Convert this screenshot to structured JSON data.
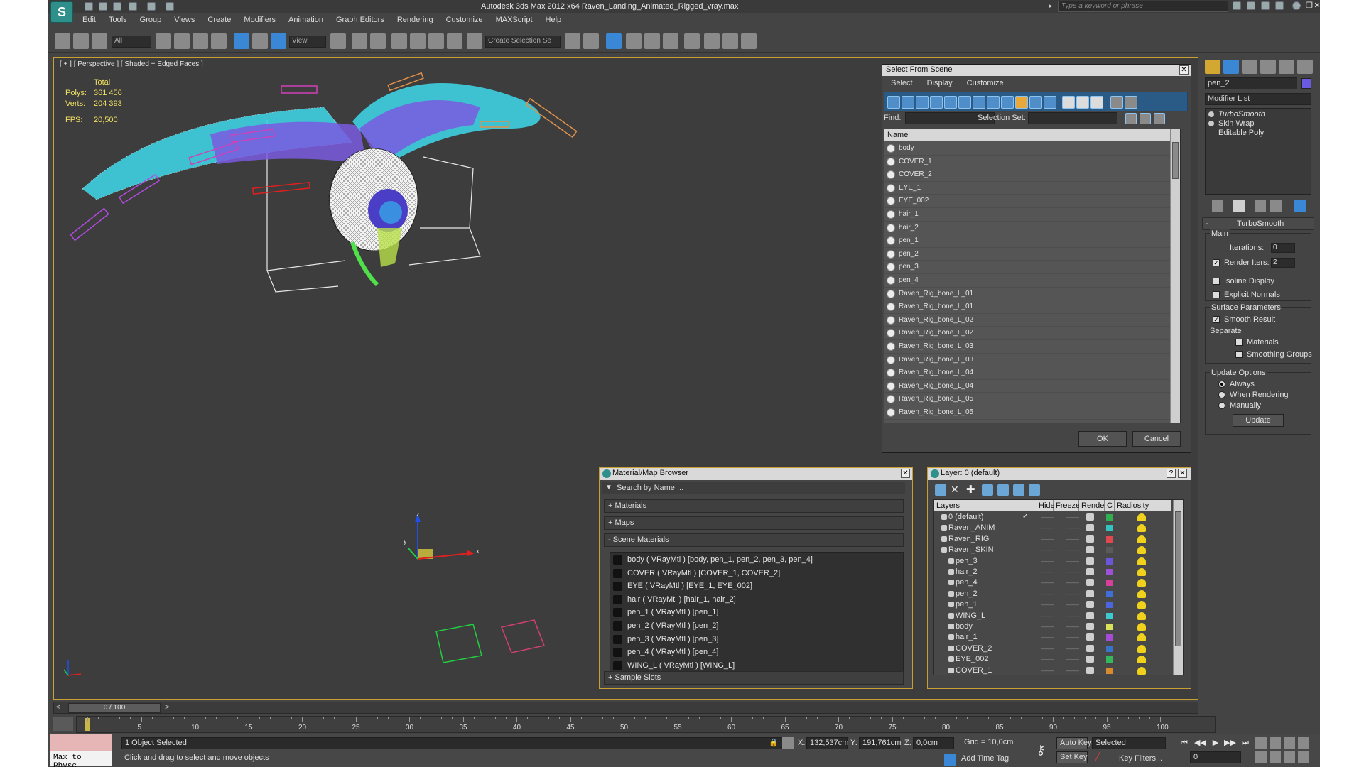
{
  "title": "Autodesk 3ds Max  2012 x64      Raven_Landing_Animated_Rigged_vray.max",
  "app_logo": "S",
  "search_placeholder": "Type a keyword or phrase",
  "menu": [
    "Edit",
    "Tools",
    "Group",
    "Views",
    "Create",
    "Modifiers",
    "Animation",
    "Graph Editors",
    "Rendering",
    "Customize",
    "MAXScript",
    "Help"
  ],
  "toolbar": {
    "selection_filter": "All",
    "ref_coord": "View",
    "named_selection": "Create Selection Se"
  },
  "viewport": {
    "label": "[ + ] [ Perspective ] [ Shaded + Edged Faces ]",
    "stats": {
      "total_label": "Total",
      "polys_label": "Polys:",
      "polys_value": "361 456",
      "verts_label": "Verts:",
      "verts_value": "204 393",
      "fps_label": "FPS:",
      "fps_value": "20,500"
    }
  },
  "select_from_scene": {
    "title": "Select From Scene",
    "menu": [
      "Select",
      "Display",
      "Customize"
    ],
    "find_label": "Find:",
    "selection_set_label": "Selection Set:",
    "column_name": "Name",
    "items": [
      "body",
      "COVER_1",
      "COVER_2",
      "EYE_1",
      "EYE_002",
      "hair_1",
      "hair_2",
      "pen_1",
      "pen_2",
      "pen_3",
      "pen_4",
      "Raven_Rig_bone_L_01",
      "Raven_Rig_bone_L_01",
      "Raven_Rig_bone_L_02",
      "Raven_Rig_bone_L_02",
      "Raven_Rig_bone_L_03",
      "Raven_Rig_bone_L_03",
      "Raven_Rig_bone_L_04",
      "Raven_Rig_bone_L_04",
      "Raven_Rig_bone_L_05",
      "Raven_Rig_bone_L_05"
    ],
    "ok_label": "OK",
    "cancel_label": "Cancel"
  },
  "material_browser": {
    "title": "Material/Map Browser",
    "search_placeholder": "Search by Name ...",
    "sections": {
      "materials": "+ Materials",
      "maps": "+ Maps",
      "scene_materials": "- Scene Materials",
      "sample_slots": "+ Sample Slots"
    },
    "scene_materials": [
      "body  ( VRayMtl )  [body, pen_1, pen_2, pen_3, pen_4]",
      "COVER  ( VRayMtl )  [COVER_1, COVER_2]",
      "EYE  ( VRayMtl )  [EYE_1, EYE_002]",
      "hair  ( VRayMtl )  [hair_1, hair_2]",
      "pen_1  ( VRayMtl )  [pen_1]",
      "pen_2  ( VRayMtl )  [pen_2]",
      "pen_3  ( VRayMtl )  [pen_3]",
      "pen_4  ( VRayMtl )  [pen_4]",
      "WING_L  ( VRayMtl )  [WING_L]"
    ]
  },
  "layer_manager": {
    "title": "Layer: 0 (default)",
    "help": "?",
    "columns": [
      "Layers",
      "Hide",
      "Freeze",
      "Render",
      "C",
      "Radiosity"
    ],
    "rows": [
      {
        "name": "0 (default)",
        "indent": 0,
        "color": "#2fae52",
        "check": "✓"
      },
      {
        "name": "Raven_ANIM",
        "indent": 0,
        "color": "#34c2c2",
        "check": ""
      },
      {
        "name": "Raven_RIG",
        "indent": 0,
        "color": "#e0484f",
        "check": ""
      },
      {
        "name": "Raven_SKIN",
        "indent": 0,
        "color": "#5a5a5a",
        "check": ""
      },
      {
        "name": "pen_3",
        "indent": 1,
        "color": "#6b55d9",
        "check": ""
      },
      {
        "name": "hair_2",
        "indent": 1,
        "color": "#9b52d6",
        "check": ""
      },
      {
        "name": "pen_4",
        "indent": 1,
        "color": "#d6409a",
        "check": ""
      },
      {
        "name": "pen_2",
        "indent": 1,
        "color": "#3f6fd8",
        "check": ""
      },
      {
        "name": "pen_1",
        "indent": 1,
        "color": "#4a66e0",
        "check": ""
      },
      {
        "name": "WING_L",
        "indent": 1,
        "color": "#3cc9cf",
        "check": ""
      },
      {
        "name": "body",
        "indent": 1,
        "color": "#d8e35a",
        "check": ""
      },
      {
        "name": "hair_1",
        "indent": 1,
        "color": "#a64ad8",
        "check": ""
      },
      {
        "name": "COVER_2",
        "indent": 1,
        "color": "#3874c9",
        "check": ""
      },
      {
        "name": "EYE_002",
        "indent": 1,
        "color": "#34b85b",
        "check": ""
      },
      {
        "name": "COVER_1",
        "indent": 1,
        "color": "#d98a2f",
        "check": ""
      }
    ]
  },
  "command_panel": {
    "object_name": "pen_2",
    "modifier_list": "Modifier List",
    "stack": [
      "TurboSmooth",
      "Skin Wrap",
      "Editable Poly"
    ],
    "turbosmooth": {
      "title": "TurboSmooth",
      "main": "Main",
      "iterations_label": "Iterations:",
      "iterations_value": "0",
      "render_iters_label": "Render Iters:",
      "render_iters_value": "2",
      "isoline": "Isoline Display",
      "explicit_normals": "Explicit Normals",
      "surface_params": "Surface Parameters",
      "smooth_result": "Smooth Result",
      "separate": "Separate",
      "materials": "Materials",
      "smoothing_groups": "Smoothing Groups",
      "update_options": "Update Options",
      "always": "Always",
      "when_rendering": "When Rendering",
      "manually": "Manually",
      "update": "Update"
    }
  },
  "timeline": {
    "frame": "0 / 100",
    "ticks": [
      "5",
      "10",
      "15",
      "20",
      "25",
      "30",
      "35",
      "40",
      "45",
      "50",
      "55",
      "60",
      "65",
      "70",
      "75",
      "80",
      "85",
      "90",
      "95",
      "100"
    ]
  },
  "status": {
    "maxscript": "Max to Physc",
    "selected": "1 Object Selected",
    "prompt": "Click and drag to select and move objects",
    "x_label": "X:",
    "x_value": "132,537cm",
    "y_label": "Y:",
    "y_value": "191,761cm",
    "z_label": "Z:",
    "z_value": "0,0cm",
    "grid": "Grid = 10,0cm",
    "add_time_tag": "Add Time Tag",
    "auto_key": "Auto Key",
    "set_key": "Set Key",
    "selected_dd": "Selected",
    "key_filters": "Key Filters...",
    "frame_value": "0"
  }
}
